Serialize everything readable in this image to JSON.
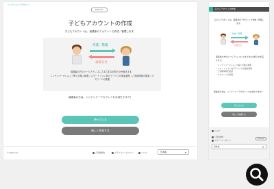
{
  "desktop": {
    "brand": "ニンテンドーアカウント",
    "logo": "Nintendo",
    "title": "子どもアカウントの作成",
    "subtitle": "子どもアカウントは、保護者のアカウントで作成／管理します。",
    "illustration": {
      "create_label": "作成／管理",
      "notify_label": "お知らせ"
    },
    "panel_text_1": "保護者の方のメールアドレスにさまざまなお知らせが届きます。",
    "panel_text_2": "ニンテンドーeショップ等での購入制限 / スマートフォン向けアプリでの課金通知 / ご利用時間の更新 / パスワードの変更",
    "question": "保護者の方は、ニンテンドーアカウントをお持ちですか？",
    "yes_button": "持っている",
    "no_button": "新しく作成する",
    "footer": {
      "copyright": "© Nintendo",
      "link_terms": "ご利用規約",
      "link_privacy": "プライバシーポリシー",
      "link_help": "ヘルプ",
      "language": "日本語"
    }
  },
  "mobile": {
    "header_title": "子どもアカウントの作成",
    "subtitle": "子どもアカウントは、保護者のアカウントで作成／管理します。",
    "create_label": "作成／管理",
    "notify_label": "お知らせ",
    "notice_text": "保護者の方のメールアドレスにさまざまなお知らせが届きます。",
    "list": [
      "・ニンテンドーeショップ等での購入制限",
      "・スマートフォン向けアプリでの課金通知",
      "・ご利用時間の更新",
      "・パスワードの変更"
    ],
    "question": "保護者の方は、ニンテンドーアカウントをお持ちですか？",
    "yes_button": "持っている",
    "no_button": "新しく作成する",
    "help": "ヘルプ",
    "link_terms": "ご利用規約",
    "link_privacy": "プライバシーポリシー",
    "logo": "Nintendo",
    "language": "日本語"
  },
  "colors": {
    "accent_teal": "#5bc6b8",
    "accent_red": "#f08a8a",
    "secondary_button": "#7a7a7a"
  },
  "icons": {
    "search": "search-icon"
  }
}
